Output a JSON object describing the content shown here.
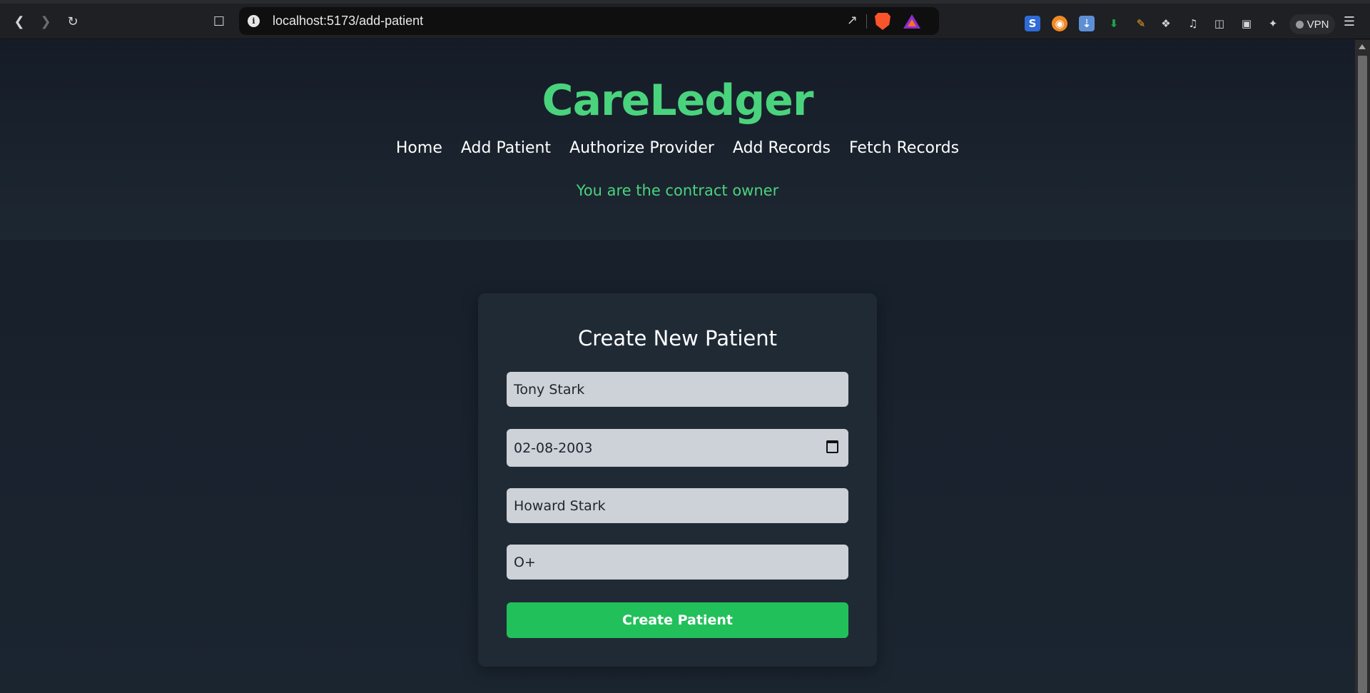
{
  "browser": {
    "url": "localhost:5173/add-patient",
    "vpn_label": "VPN"
  },
  "app": {
    "brand": "CareLedger",
    "nav": [
      "Home",
      "Add Patient",
      "Authorize Provider",
      "Add Records",
      "Fetch Records"
    ],
    "owner_status": "You are the contract owner"
  },
  "form": {
    "title": "Create New Patient",
    "name_value": "Tony Stark",
    "dob_value": "02-08-2003",
    "guardian_value": "Howard Stark",
    "blood_group_value": "O+",
    "submit_label": "Create Patient"
  },
  "colors": {
    "accent": "#4ad37d",
    "button": "#22c05a",
    "background": "#18202b",
    "card": "#1f2a35",
    "input": "#cdd1d8"
  },
  "icons": [
    "back-icon",
    "forward-icon",
    "reload-icon",
    "bookmark-icon",
    "info-icon",
    "share-icon",
    "brave-shield-icon",
    "brave-rewards-icon",
    "calendar-icon",
    "menu-icon"
  ]
}
